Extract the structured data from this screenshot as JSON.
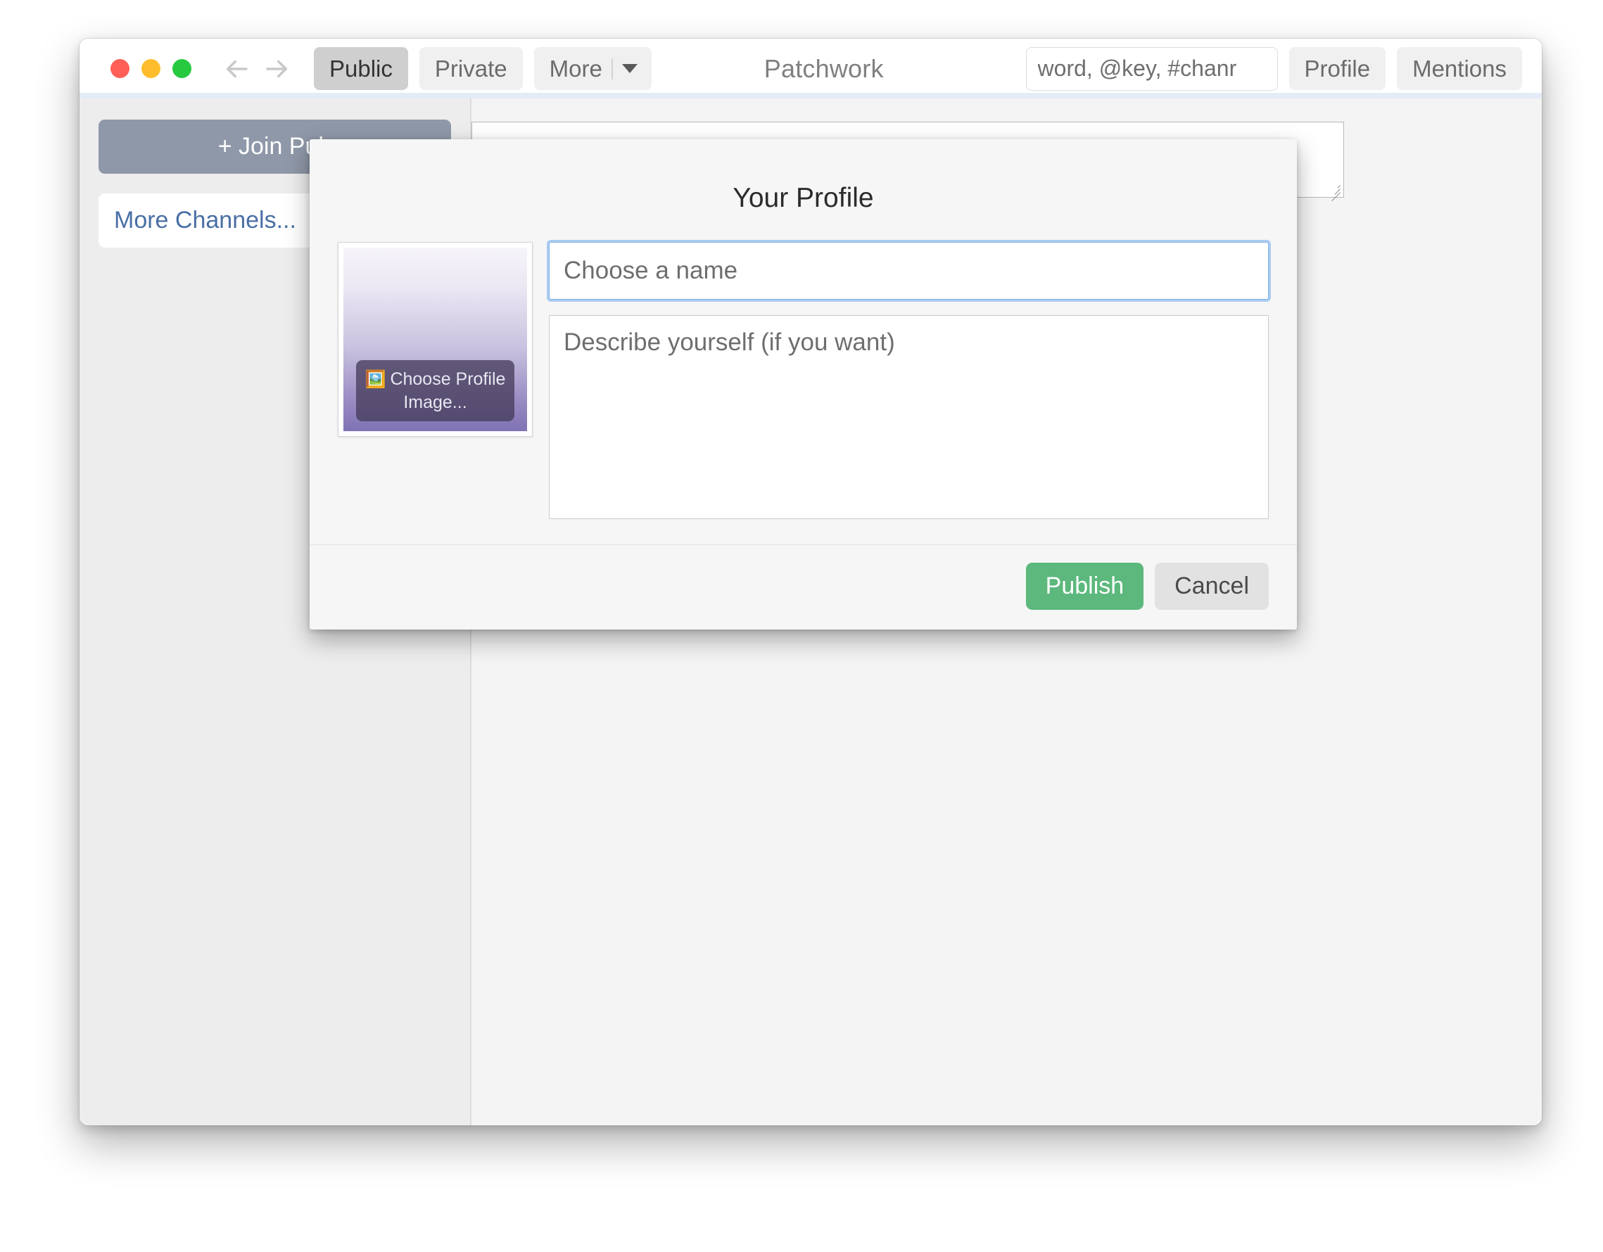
{
  "window": {
    "title": "Patchwork",
    "traffic_lights": [
      {
        "name": "close",
        "color": "#ff5f56"
      },
      {
        "name": "minimize",
        "color": "#ffbd2e"
      },
      {
        "name": "zoom",
        "color": "#27c93f"
      }
    ],
    "nav": {
      "back": "back-arrow",
      "forward": "forward-arrow"
    }
  },
  "toolbar": {
    "tabs": [
      {
        "label": "Public",
        "active": true
      },
      {
        "label": "Private",
        "active": false
      }
    ],
    "more_label": "More",
    "search": {
      "placeholder": "word, @key, #chanr",
      "value": ""
    },
    "profile_label": "Profile",
    "mentions_label": "Mentions"
  },
  "sidebar": {
    "join_label": "+ Join Pub",
    "more_channels_label": "More Channels..."
  },
  "main": {
    "compose_placeholder": ""
  },
  "modal": {
    "title": "Your Profile",
    "choose_image_label": "Choose Profile Image...",
    "choose_image_icon": "🖼️",
    "name_placeholder": "Choose a name",
    "name_value": "",
    "bio_placeholder": "Describe yourself (if you want)",
    "bio_value": "",
    "publish_label": "Publish",
    "cancel_label": "Cancel",
    "accent_publish_color": "#5cb87c",
    "focus_ring_color": "#7fb3e8"
  }
}
